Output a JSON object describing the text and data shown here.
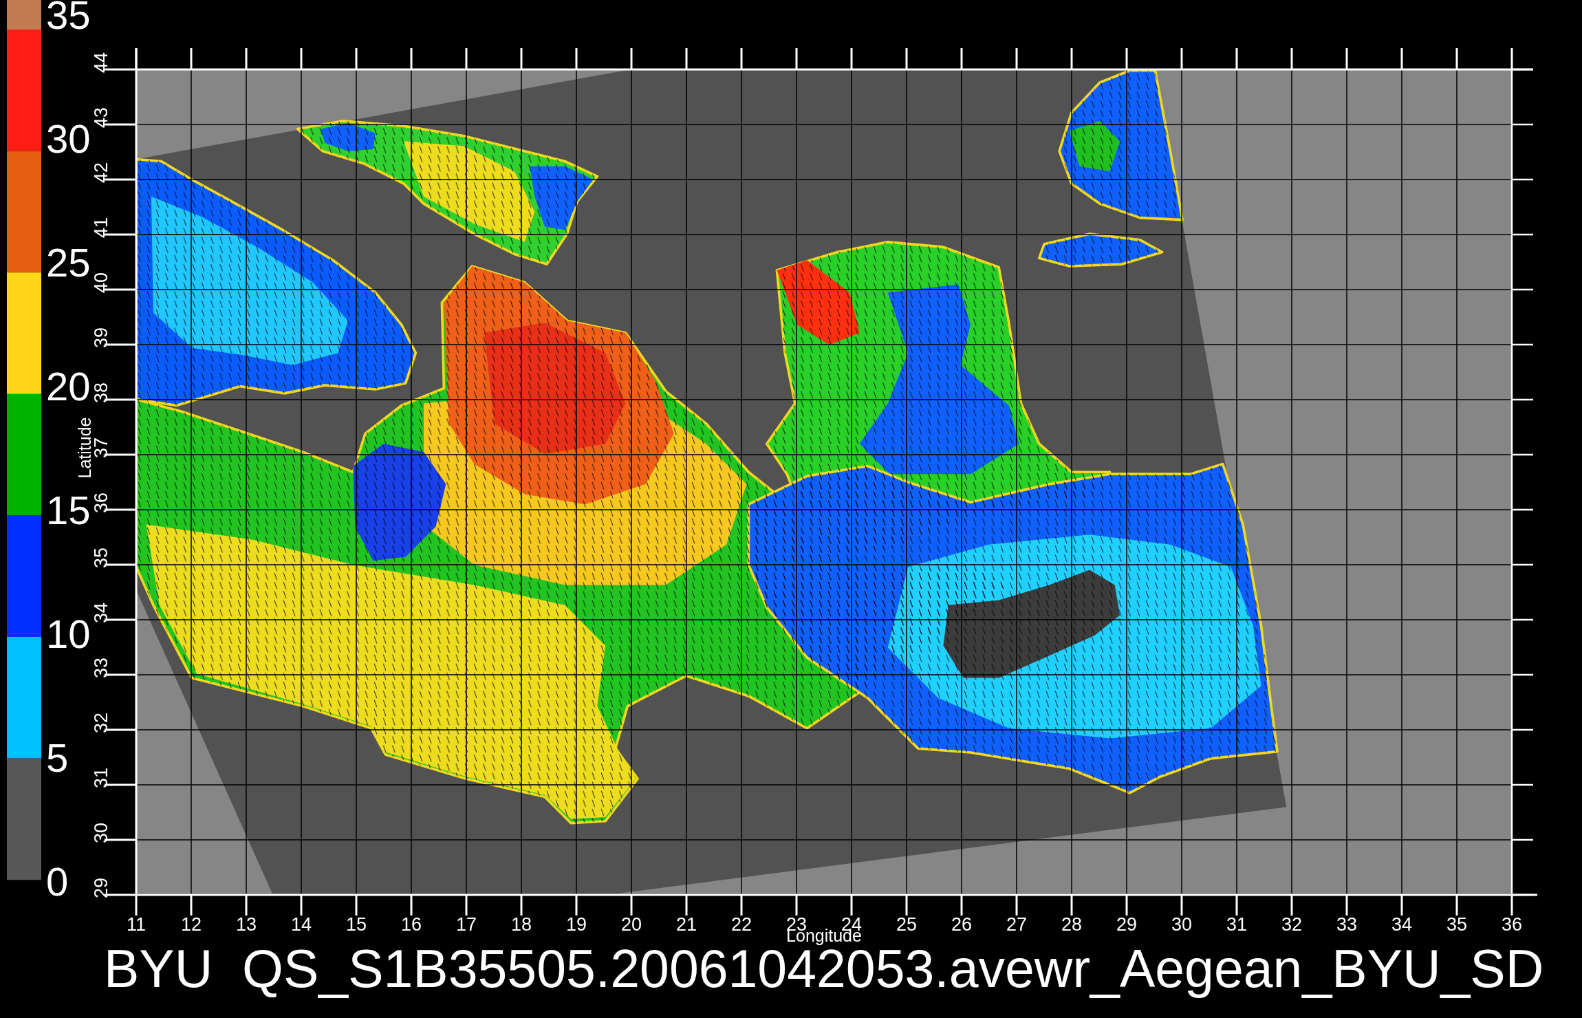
{
  "colorbar": {
    "ticks": [
      "35",
      "30",
      "25",
      "20",
      "15",
      "10",
      "5",
      "0"
    ],
    "bands": [
      {
        "color": "#c27b51"
      },
      {
        "color": "#ff1c14"
      },
      {
        "color": "#e45f10"
      },
      {
        "color": "#ffd618"
      },
      {
        "color": "#00b400"
      },
      {
        "color": "#0030ff"
      },
      {
        "color": "#00c0ff"
      },
      {
        "color": "#585858"
      }
    ]
  },
  "plot": {
    "y_axis": {
      "label": "Latitude",
      "ticks": [
        "44",
        "43",
        "42",
        "41",
        "40",
        "39",
        "38",
        "37",
        "36",
        "35",
        "34",
        "33",
        "32",
        "31",
        "30",
        "29"
      ]
    },
    "x_axis": {
      "label": "Longitude",
      "ticks": [
        "11",
        "12",
        "13",
        "14",
        "15",
        "16",
        "17",
        "18",
        "19",
        "20",
        "21",
        "22",
        "23",
        "24",
        "25",
        "26",
        "27",
        "28",
        "29",
        "30",
        "31",
        "32",
        "33",
        "34",
        "35",
        "36"
      ]
    }
  },
  "title": "BYU  QS_S1B35505.20061042053.avewr_Aegean_BYU_SD"
}
